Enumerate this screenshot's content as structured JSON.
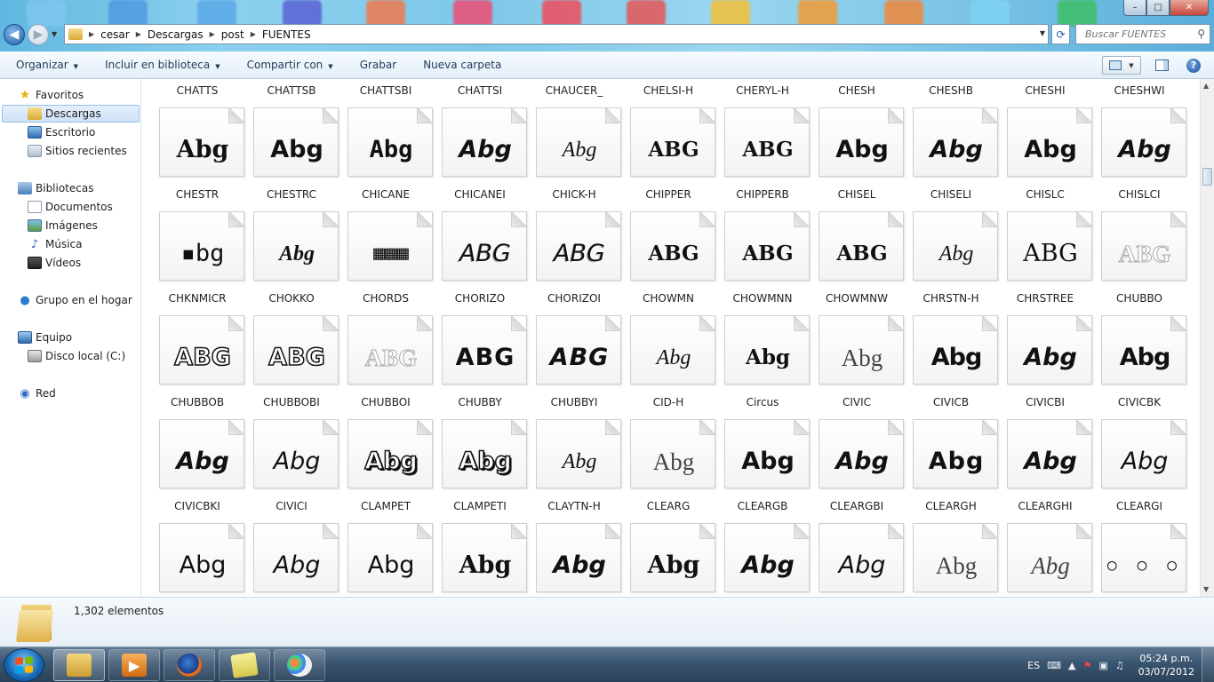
{
  "window": {
    "minimize_glyph": "–",
    "maximize_glyph": "□",
    "close_glyph": "✕"
  },
  "address": {
    "crumbs": [
      "cesar",
      "Descargas",
      "post",
      "FUENTES"
    ],
    "search_placeholder": "Buscar FUENTES"
  },
  "toolbar": {
    "organize": "Organizar",
    "include_library": "Incluir en biblioteca",
    "share_with": "Compartir con",
    "burn": "Grabar",
    "new_folder": "Nueva carpeta"
  },
  "sidebar": {
    "favorites": "Favoritos",
    "downloads": "Descargas",
    "desktop": "Escritorio",
    "recent": "Sitios recientes",
    "libraries": "Bibliotecas",
    "documents": "Documentos",
    "images": "Imágenes",
    "music": "Música",
    "videos": "Vídeos",
    "homegroup": "Grupo en el hogar",
    "computer": "Equipo",
    "local_disk": "Disco local (C:)",
    "network": "Red"
  },
  "fonts": [
    {
      "name": "CHATTS",
      "sample": "Abg"
    },
    {
      "name": "CHATTSB",
      "sample": "Abg"
    },
    {
      "name": "CHATTSBI",
      "sample": "Abg"
    },
    {
      "name": "CHATTSI",
      "sample": "Abg"
    },
    {
      "name": "CHAUCER_",
      "sample": "Abg"
    },
    {
      "name": "CHELSI-H",
      "sample": "ABG"
    },
    {
      "name": "CHERYL-H",
      "sample": "ABG"
    },
    {
      "name": "CHESH",
      "sample": "Abg"
    },
    {
      "name": "CHESHB",
      "sample": "Abg"
    },
    {
      "name": "CHESHI",
      "sample": "Abg"
    },
    {
      "name": "CHESHWI",
      "sample": "Abg"
    },
    {
      "name": "CHESTR",
      "sample": "▪bg"
    },
    {
      "name": "CHESTRC",
      "sample": "Abg"
    },
    {
      "name": "CHICANE",
      "sample": "▦▦▦"
    },
    {
      "name": "CHICANEI",
      "sample": "ABG"
    },
    {
      "name": "CHICK-H",
      "sample": "ABG"
    },
    {
      "name": "CHIPPER",
      "sample": "ABG"
    },
    {
      "name": "CHIPPERB",
      "sample": "ABG"
    },
    {
      "name": "CHISEL",
      "sample": "ABG"
    },
    {
      "name": "CHISELI",
      "sample": "Abg"
    },
    {
      "name": "CHISLC",
      "sample": "ABG"
    },
    {
      "name": "CHISLCI",
      "sample": "ABG"
    },
    {
      "name": "CHKNMICR",
      "sample": "ABG"
    },
    {
      "name": "CHOKKO",
      "sample": "ABG"
    },
    {
      "name": "CHORDS",
      "sample": "ABG"
    },
    {
      "name": "CHORIZO",
      "sample": "ABG"
    },
    {
      "name": "CHORIZOI",
      "sample": "ABG"
    },
    {
      "name": "CHOWMN",
      "sample": "Abg"
    },
    {
      "name": "CHOWMNN",
      "sample": "Abg"
    },
    {
      "name": "CHOWMNW",
      "sample": "Abg"
    },
    {
      "name": "CHRSTN-H",
      "sample": "Abg"
    },
    {
      "name": "CHRSTREE",
      "sample": "Abg"
    },
    {
      "name": "CHUBBO",
      "sample": "Abg"
    },
    {
      "name": "CHUBBOB",
      "sample": "Abg"
    },
    {
      "name": "CHUBBOBI",
      "sample": "Abg"
    },
    {
      "name": "CHUBBOI",
      "sample": "Abg"
    },
    {
      "name": "CHUBBY",
      "sample": "Abg"
    },
    {
      "name": "CHUBBYI",
      "sample": "Abg"
    },
    {
      "name": "CID-H",
      "sample": "Abg"
    },
    {
      "name": "Circus",
      "sample": "Abg"
    },
    {
      "name": "CIVIC",
      "sample": "Abg"
    },
    {
      "name": "CIVICB",
      "sample": "Abg"
    },
    {
      "name": "CIVICBI",
      "sample": "Abg"
    },
    {
      "name": "CIVICBK",
      "sample": "Abg"
    },
    {
      "name": "CIVICBKI",
      "sample": "Abg"
    },
    {
      "name": "CIVICI",
      "sample": "Abg"
    },
    {
      "name": "CLAMPET",
      "sample": "Abg"
    },
    {
      "name": "CLAMPETI",
      "sample": "Abg"
    },
    {
      "name": "CLAYTN-H",
      "sample": "Abg"
    },
    {
      "name": "CLEARG",
      "sample": "Abg"
    },
    {
      "name": "CLEARGB",
      "sample": "Abg"
    },
    {
      "name": "CLEARGBI",
      "sample": "Abg"
    },
    {
      "name": "CLEARGH",
      "sample": "Abg"
    },
    {
      "name": "CLEARGHI",
      "sample": "Abg"
    },
    {
      "name": "CLEARGI",
      "sample": "○ ○ ○"
    }
  ],
  "details": {
    "count": "1,302 elementos"
  },
  "taskbar": {
    "language": "ES",
    "time": "05:24 p.m.",
    "date": "03/07/2012"
  }
}
